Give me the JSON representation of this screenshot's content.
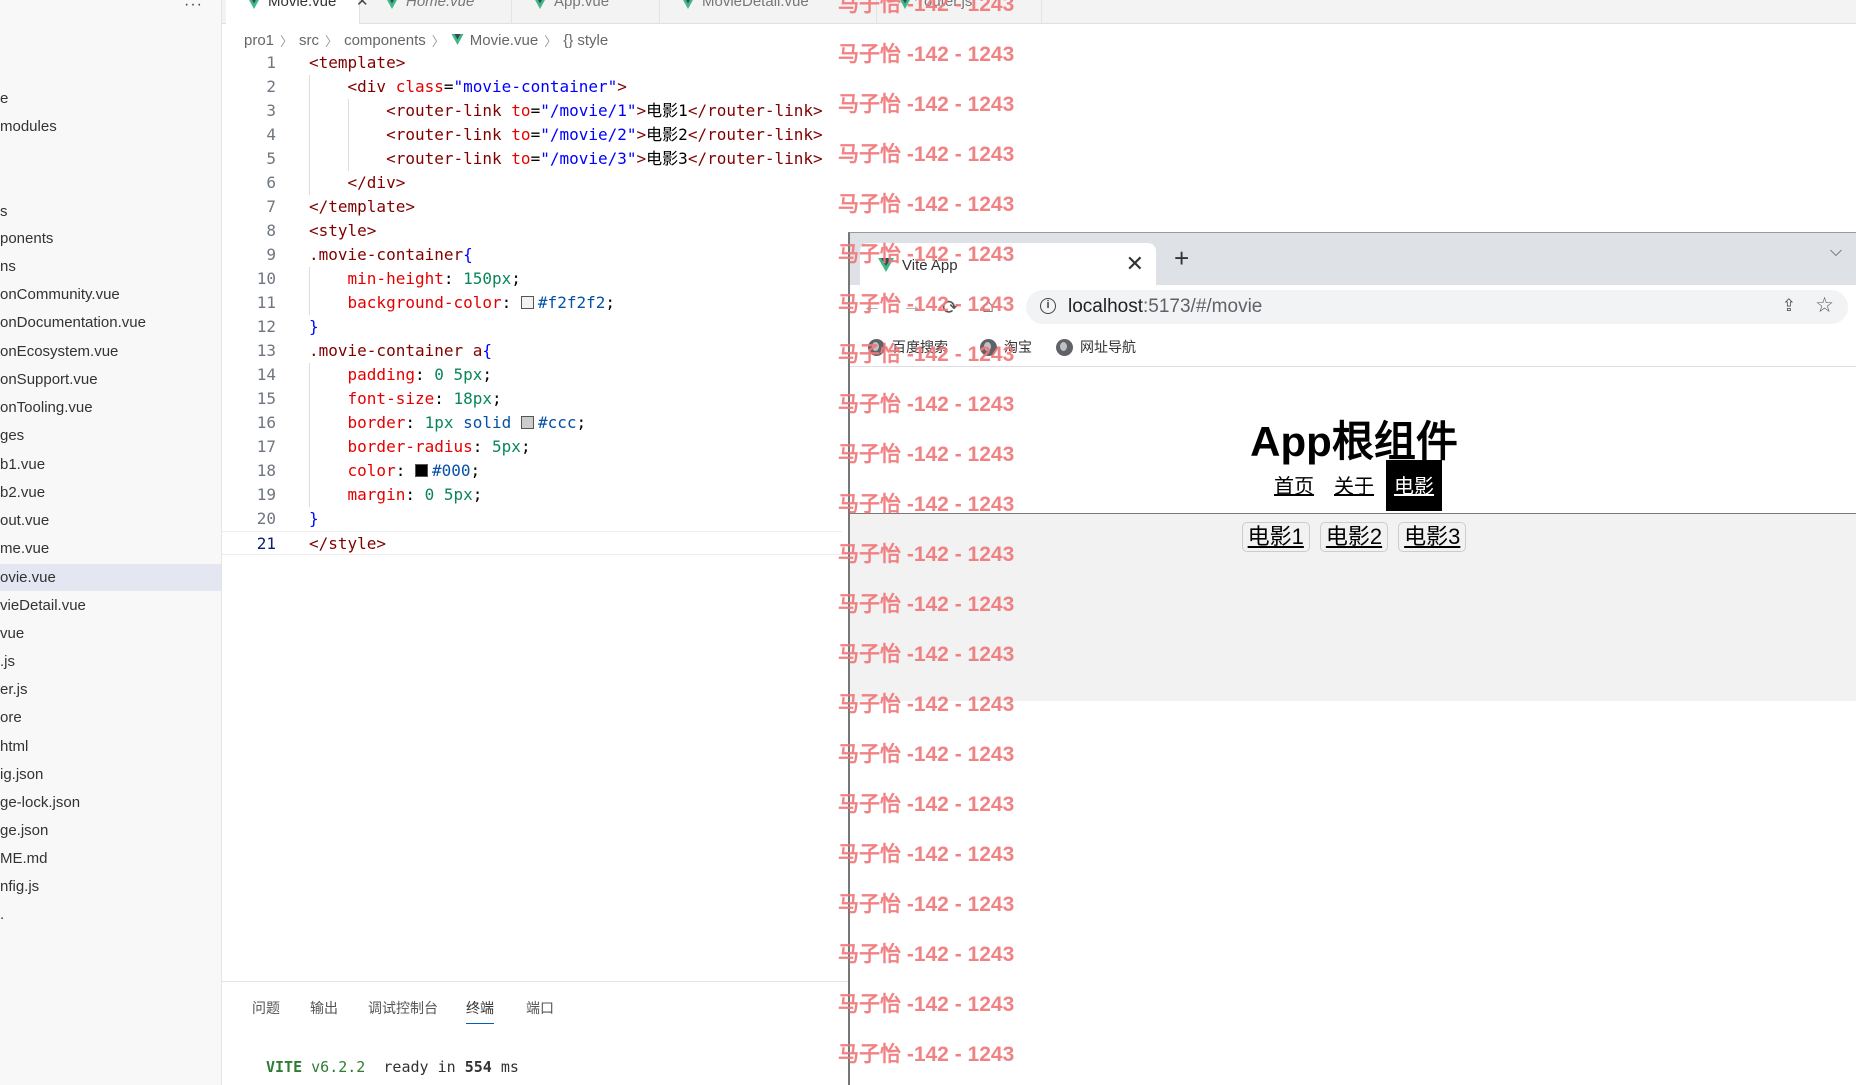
{
  "explorer": {
    "more_glyph": "···",
    "items": [
      "e",
      "modules",
      "s",
      "ponents",
      "ns",
      "onCommunity.vue",
      "onDocumentation.vue",
      "onEcosystem.vue",
      "onSupport.vue",
      "onTooling.vue",
      "ges",
      "b1.vue",
      "b2.vue",
      "out.vue",
      "me.vue",
      "ovie.vue",
      "vieDetail.vue",
      "vue",
      ".js",
      "er.js",
      "ore",
      "html",
      "ig.json",
      "ge-lock.json",
      "ge.json",
      "ME.md",
      "nfig.js",
      "."
    ],
    "active_index": 15
  },
  "tabs": [
    {
      "label": "Movie.vue",
      "close": "✕",
      "active": true
    },
    {
      "label": "Home.vue",
      "active": false,
      "italic": true
    },
    {
      "label": "App.vue",
      "active": false
    },
    {
      "label": "MovieDetail.vue",
      "active": false
    },
    {
      "label": "router.js",
      "active": false
    }
  ],
  "breadcrumb": {
    "items": [
      "pro1",
      "src",
      "components",
      "Movie.vue",
      "{} style"
    ]
  },
  "code": {
    "current_line": 21,
    "lines": [
      {
        "n": "1",
        "tokens": [
          [
            "tag",
            "<template>"
          ]
        ]
      },
      {
        "n": "2",
        "tokens": [
          [
            "plain",
            "    "
          ],
          [
            "tag",
            "<div "
          ],
          [
            "attr",
            "class"
          ],
          [
            "plain",
            "="
          ],
          [
            "str",
            "\"movie-container\""
          ],
          [
            "tag",
            ">"
          ]
        ]
      },
      {
        "n": "3",
        "tokens": [
          [
            "plain",
            "        "
          ],
          [
            "tag",
            "<router-link "
          ],
          [
            "attr",
            "to"
          ],
          [
            "plain",
            "="
          ],
          [
            "str",
            "\"/movie/1\""
          ],
          [
            "tag",
            ">"
          ],
          [
            "plain",
            "电影1"
          ],
          [
            "tag",
            "</router-link>"
          ]
        ]
      },
      {
        "n": "4",
        "tokens": [
          [
            "plain",
            "        "
          ],
          [
            "tag",
            "<router-link "
          ],
          [
            "attr",
            "to"
          ],
          [
            "plain",
            "="
          ],
          [
            "str",
            "\"/movie/2\""
          ],
          [
            "tag",
            ">"
          ],
          [
            "plain",
            "电影2"
          ],
          [
            "tag",
            "</router-link>"
          ]
        ]
      },
      {
        "n": "5",
        "tokens": [
          [
            "plain",
            "        "
          ],
          [
            "tag",
            "<router-link "
          ],
          [
            "attr",
            "to"
          ],
          [
            "plain",
            "="
          ],
          [
            "str",
            "\"/movie/3\""
          ],
          [
            "tag",
            ">"
          ],
          [
            "plain",
            "电影3"
          ],
          [
            "tag",
            "</router-link>"
          ]
        ]
      },
      {
        "n": "6",
        "tokens": [
          [
            "plain",
            "    "
          ],
          [
            "tag",
            "</div>"
          ]
        ]
      },
      {
        "n": "7",
        "tokens": [
          [
            "tag",
            "</template>"
          ]
        ]
      },
      {
        "n": "8",
        "tokens": [
          [
            "tag",
            "<style>"
          ]
        ]
      },
      {
        "n": "9",
        "tokens": [
          [
            "sel",
            ".movie-container"
          ],
          [
            "brace",
            "{"
          ]
        ]
      },
      {
        "n": "10",
        "tokens": [
          [
            "plain",
            "    "
          ],
          [
            "prop",
            "min-height"
          ],
          [
            "plain",
            ": "
          ],
          [
            "num",
            "150px"
          ],
          [
            "plain",
            ";"
          ]
        ]
      },
      {
        "n": "11",
        "tokens": [
          [
            "plain",
            "    "
          ],
          [
            "prop",
            "background-color"
          ],
          [
            "plain",
            ": "
          ],
          [
            "swatch",
            "#f2f2f2"
          ],
          [
            "val",
            "#f2f2f2"
          ],
          [
            "plain",
            ";"
          ]
        ]
      },
      {
        "n": "12",
        "tokens": [
          [
            "brace",
            "}"
          ]
        ]
      },
      {
        "n": "13",
        "tokens": [
          [
            "sel",
            ".movie-container a"
          ],
          [
            "brace",
            "{"
          ]
        ]
      },
      {
        "n": "14",
        "tokens": [
          [
            "plain",
            "    "
          ],
          [
            "prop",
            "padding"
          ],
          [
            "plain",
            ": "
          ],
          [
            "num",
            "0 5px"
          ],
          [
            "plain",
            ";"
          ]
        ]
      },
      {
        "n": "15",
        "tokens": [
          [
            "plain",
            "    "
          ],
          [
            "prop",
            "font-size"
          ],
          [
            "plain",
            ": "
          ],
          [
            "num",
            "18px"
          ],
          [
            "plain",
            ";"
          ]
        ]
      },
      {
        "n": "16",
        "tokens": [
          [
            "plain",
            "    "
          ],
          [
            "prop",
            "border"
          ],
          [
            "plain",
            ": "
          ],
          [
            "num",
            "1px"
          ],
          [
            "plain",
            " "
          ],
          [
            "val",
            "solid"
          ],
          [
            "plain",
            " "
          ],
          [
            "swatch",
            "#ccc"
          ],
          [
            "val",
            "#ccc"
          ],
          [
            "plain",
            ";"
          ]
        ]
      },
      {
        "n": "17",
        "tokens": [
          [
            "plain",
            "    "
          ],
          [
            "prop",
            "border-radius"
          ],
          [
            "plain",
            ": "
          ],
          [
            "num",
            "5px"
          ],
          [
            "plain",
            ";"
          ]
        ]
      },
      {
        "n": "18",
        "tokens": [
          [
            "plain",
            "    "
          ],
          [
            "prop",
            "color"
          ],
          [
            "plain",
            ": "
          ],
          [
            "swatch",
            "#000"
          ],
          [
            "val",
            "#000"
          ],
          [
            "plain",
            ";"
          ]
        ]
      },
      {
        "n": "19",
        "tokens": [
          [
            "plain",
            "    "
          ],
          [
            "prop",
            "margin"
          ],
          [
            "plain",
            ": "
          ],
          [
            "num",
            "0 5px"
          ],
          [
            "plain",
            ";"
          ]
        ]
      },
      {
        "n": "20",
        "tokens": [
          [
            "brace",
            "}"
          ]
        ]
      },
      {
        "n": "21",
        "tokens": [
          [
            "tag",
            "</style>"
          ]
        ]
      }
    ]
  },
  "panel": {
    "tabs": [
      "问题",
      "输出",
      "调试控制台",
      "终端",
      "端口"
    ],
    "active_tab": "终端",
    "terminal": {
      "vite": "VITE",
      "version": "v6.2.2",
      "ready_text": "ready in",
      "ms_value": "554",
      "ms_unit": "ms"
    }
  },
  "browser": {
    "tab_title": "Vite App",
    "tab_close": "✕",
    "new_tab": "+",
    "chevron": "⌵",
    "nav": {
      "back": "←",
      "forward": "→",
      "reload": "⟳",
      "home": "⌂"
    },
    "url_host": "localhost",
    "url_rest": ":5173/#/movie",
    "info_glyph": "i",
    "share_glyph": "⇪",
    "star_glyph": "☆",
    "bookmarks": [
      "百度搜索",
      "淘宝",
      "网址导航"
    ],
    "page": {
      "title": "App根组件",
      "nav": [
        "首页",
        "关于",
        "电影"
      ],
      "current_nav": "电影",
      "movies": [
        "电影1",
        "电影2",
        "电影3"
      ]
    }
  },
  "watermark": "马子怡 -142 - 1243",
  "colors": {
    "vue_green": "#41b883",
    "accent_blue": "#005fb8",
    "watermark_red": "#f0787a",
    "movie_bg": "#f2f2f2"
  },
  "icons": {
    "vue": "vue-logo-icon",
    "globe": "globe-icon",
    "info": "info-icon",
    "share": "share-icon",
    "star": "star-icon"
  }
}
